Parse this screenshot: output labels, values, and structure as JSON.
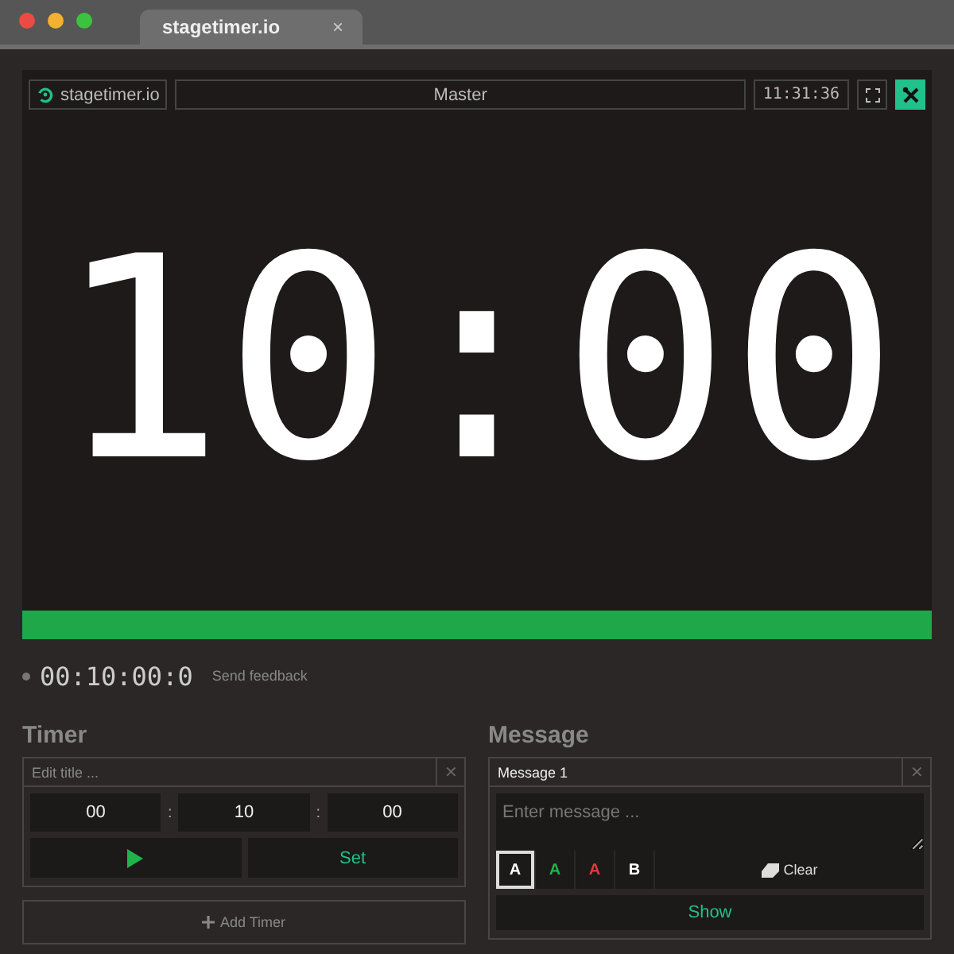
{
  "browser": {
    "tab_title": "stagetimer.io",
    "close": "×"
  },
  "stage": {
    "logo": "stagetimer.io",
    "room": "Master",
    "clock": "11:31:36",
    "timer": "10:00",
    "progress": {
      "level": 1
    }
  },
  "status": {
    "elapsed": "00:10:00:0",
    "feedback": "Send feedback"
  },
  "timer_panel": {
    "heading": "Timer",
    "title_placeholder": "Edit title ...",
    "close": "✕",
    "hours": "00",
    "minutes": "10",
    "seconds": "00",
    "separators": [
      ":",
      ":"
    ],
    "set": "Set",
    "add": "Add Timer"
  },
  "message_panel": {
    "heading": "Message",
    "title": "Message 1",
    "close": "✕",
    "placeholder": "Enter message ...",
    "formats": [
      {
        "label": "A",
        "color": "#ffffff",
        "selected": true
      },
      {
        "label": "A",
        "color": "#22b24c",
        "selected": false
      },
      {
        "label": "A",
        "color": "#e03a3a",
        "selected": false
      },
      {
        "label": "B",
        "color": "#ffffff",
        "selected": false
      }
    ],
    "clear": "Clear",
    "show": "Show"
  }
}
